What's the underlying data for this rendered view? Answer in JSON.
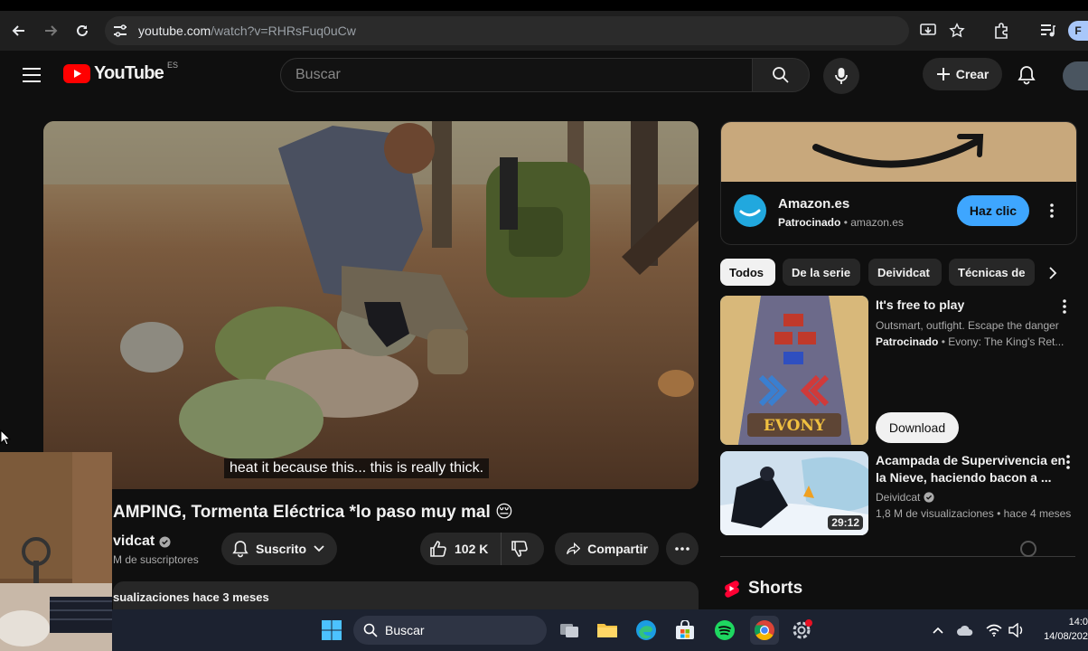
{
  "browser": {
    "url_host": "youtube.com",
    "url_path": "/watch?v=RHRsFuq0uCw",
    "profile_initial": "F"
  },
  "masthead": {
    "logo_text": "YouTube",
    "region": "ES",
    "search_placeholder": "Buscar",
    "create_label": "Crear"
  },
  "video": {
    "caption": "heat it because this... this is really thick.",
    "title": "AMPING, Tormenta Eléctrica *lo paso muy mal 😔",
    "channel": "vidcat",
    "subscribers": "M de suscriptores",
    "subscribe_label": "Suscrito",
    "likes": "102 K",
    "share_label": "Compartir",
    "views_date": "sualizaciones  hace 3 meses"
  },
  "ad": {
    "name": "Amazon.es",
    "sponsored": "Patrocinado",
    "domain": "amazon.es",
    "cta": "Haz clic"
  },
  "chips": [
    "Todos",
    "De la serie",
    "Deividcat",
    "Técnicas de"
  ],
  "recommendations": [
    {
      "title": "It's free to play",
      "desc": "Outsmart, outfight. Escape the danger",
      "sponsored": "Patrocinado",
      "advertiser": "Evony: The King's Ret...",
      "cta": "Download",
      "thumb_text": "EVONY"
    },
    {
      "title_line1": "Acampada de Supervivencia en",
      "title_line2": "la Nieve, haciendo bacon a ...",
      "channel": "Deividcat",
      "meta": "1,8 M de visualizaciones • hace 4 meses",
      "duration": "29:12"
    }
  ],
  "shorts_label": "Shorts",
  "taskbar": {
    "search_label": "Buscar",
    "time": "14:0",
    "date": "14/08/202"
  }
}
